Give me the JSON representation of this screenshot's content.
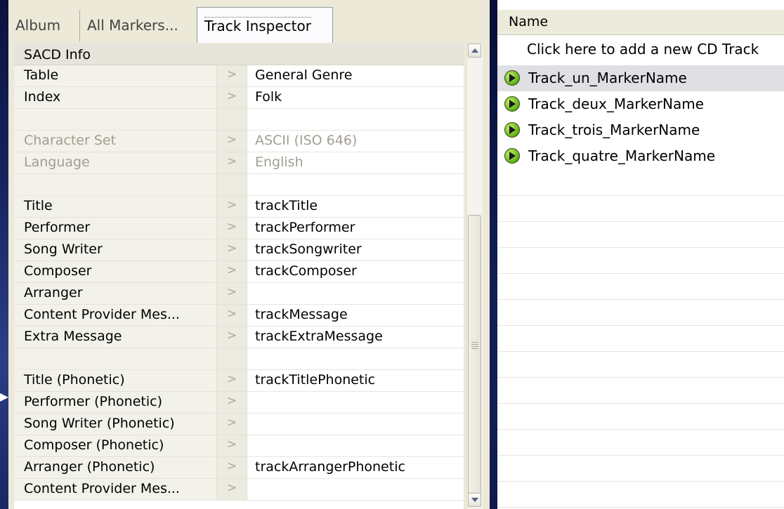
{
  "tabs": [
    {
      "label": "Album"
    },
    {
      "label": "All Markers..."
    },
    {
      "label": "Track Inspector"
    }
  ],
  "inspector": {
    "section_title": "SACD Info",
    "rows": [
      {
        "label": "Table",
        "sep": ">",
        "value": "General Genre"
      },
      {
        "label": "Index",
        "sep": ">",
        "value": "Folk"
      },
      {
        "label": "",
        "sep": "",
        "value": ""
      },
      {
        "label": "Character Set",
        "sep": ">",
        "value": "ASCII (ISO 646)"
      },
      {
        "label": "Language",
        "sep": ">",
        "value": "English"
      },
      {
        "label": "",
        "sep": "",
        "value": ""
      },
      {
        "label": "Title",
        "sep": ">",
        "value": "trackTitle"
      },
      {
        "label": "Performer",
        "sep": ">",
        "value": "trackPerformer"
      },
      {
        "label": "Song Writer",
        "sep": ">",
        "value": "trackSongwriter"
      },
      {
        "label": "Composer",
        "sep": ">",
        "value": "trackComposer"
      },
      {
        "label": "Arranger",
        "sep": ">",
        "value": ""
      },
      {
        "label": "Content Provider Mes...",
        "sep": ">",
        "value": "trackMessage"
      },
      {
        "label": "Extra Message",
        "sep": ">",
        "value": "trackExtraMessage"
      },
      {
        "label": "",
        "sep": "",
        "value": ""
      },
      {
        "label": "Title (Phonetic)",
        "sep": ">",
        "value": "trackTitlePhonetic"
      },
      {
        "label": "Performer (Phonetic)",
        "sep": ">",
        "value": ""
      },
      {
        "label": "Song Writer (Phonetic)",
        "sep": ">",
        "value": ""
      },
      {
        "label": "Composer (Phonetic)",
        "sep": ">",
        "value": ""
      },
      {
        "label": "Arranger (Phonetic)",
        "sep": ">",
        "value": "trackArrangerPhonetic"
      },
      {
        "label": "Content Provider Mes...",
        "sep": ">",
        "value": ""
      }
    ]
  },
  "tracks": {
    "column_header": "Name",
    "add_label": "Click here to add a new CD Track",
    "items": [
      {
        "name": "Track_un_MarkerName"
      },
      {
        "name": "Track_deux_MarkerName"
      },
      {
        "name": "Track_trois_MarkerName"
      },
      {
        "name": "Track_quatre_MarkerName"
      }
    ]
  }
}
